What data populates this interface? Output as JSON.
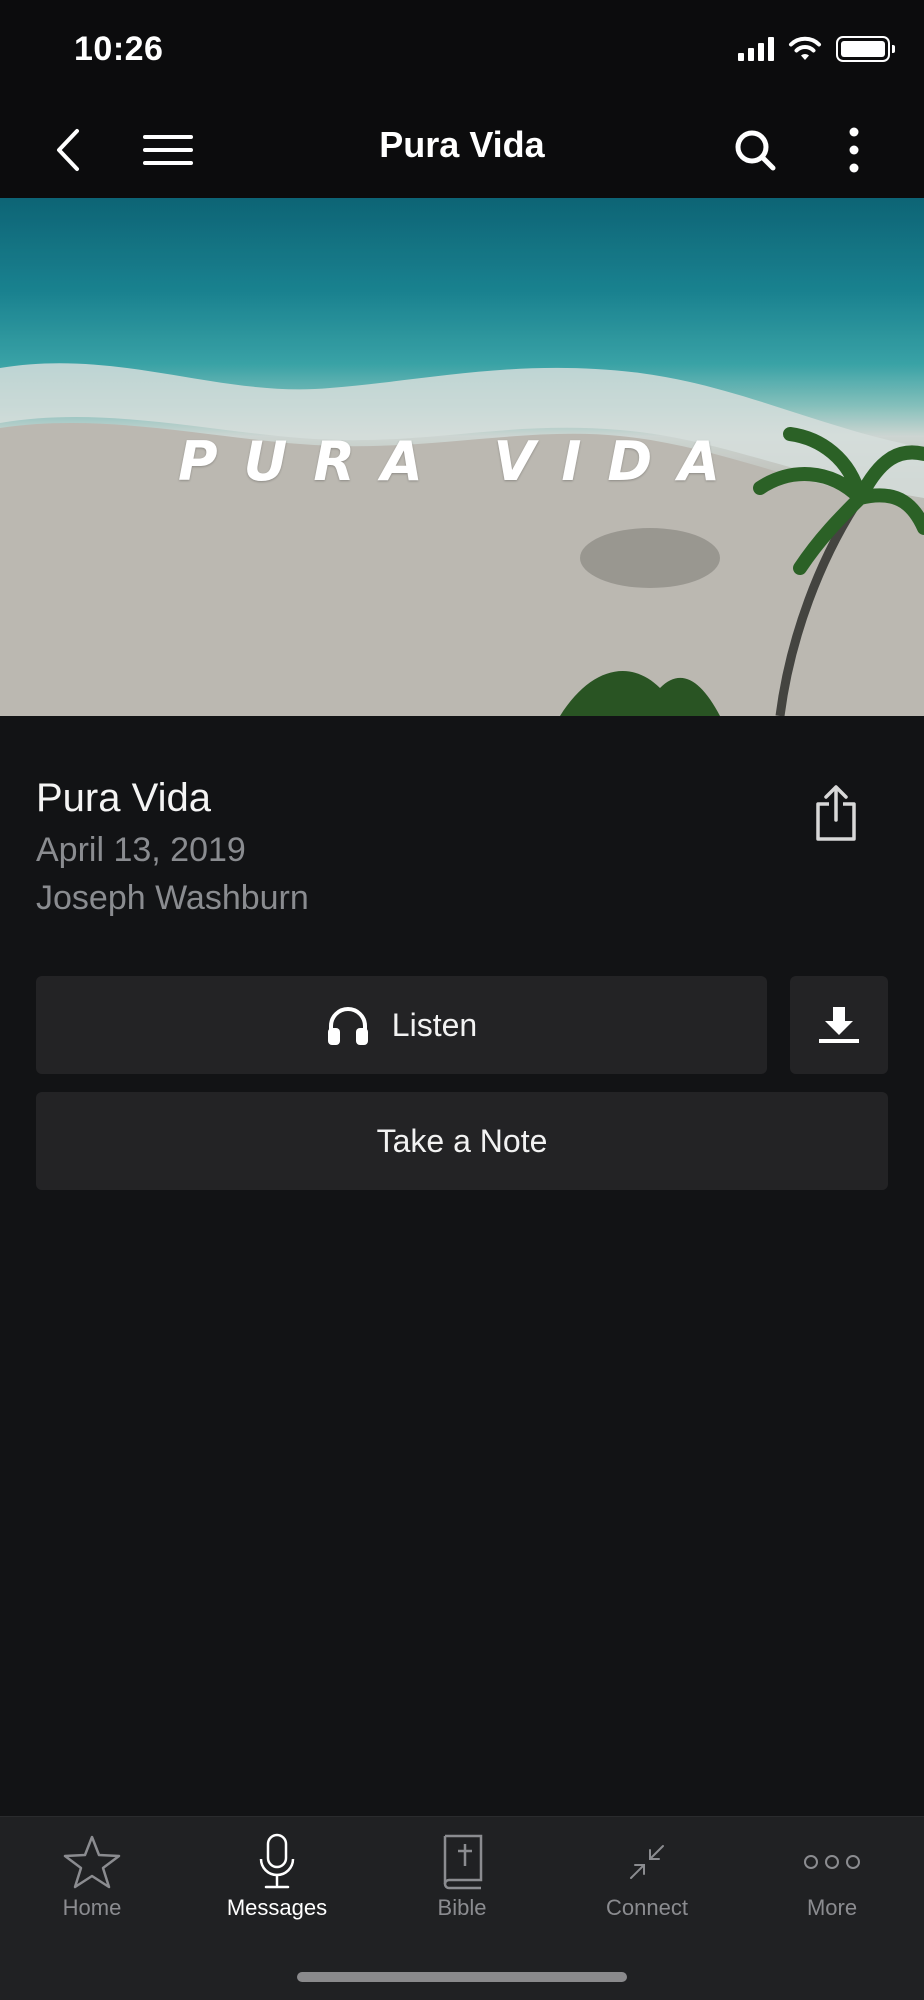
{
  "status_bar": {
    "time": "10:26"
  },
  "nav": {
    "title": "Pura Vida",
    "back_icon": "chevron-left-icon",
    "menu_icon": "hamburger-menu-icon",
    "search_icon": "search-icon",
    "more_icon": "vertical-ellipsis-icon"
  },
  "hero": {
    "title_text": "PURA VIDA"
  },
  "message": {
    "title": "Pura Vida",
    "date": "April 13, 2019",
    "speaker": "Joseph Washburn",
    "share_icon": "share-icon"
  },
  "actions": {
    "listen_label": "Listen",
    "listen_icon": "headphones-icon",
    "download_icon": "download-icon",
    "note_label": "Take a Note"
  },
  "tabs": [
    {
      "label": "Home",
      "icon": "star-icon",
      "active": false
    },
    {
      "label": "Messages",
      "icon": "microphone-icon",
      "active": true
    },
    {
      "label": "Bible",
      "icon": "bible-icon",
      "active": false
    },
    {
      "label": "Connect",
      "icon": "connect-arrows-icon",
      "active": false
    },
    {
      "label": "More",
      "icon": "horizontal-ellipsis-icon",
      "active": false
    }
  ],
  "colors": {
    "background": "#121315",
    "bar": "#0c0c0d",
    "button": "#232325",
    "tab_bar": "#202123",
    "secondary_text": "#8a8c90"
  }
}
